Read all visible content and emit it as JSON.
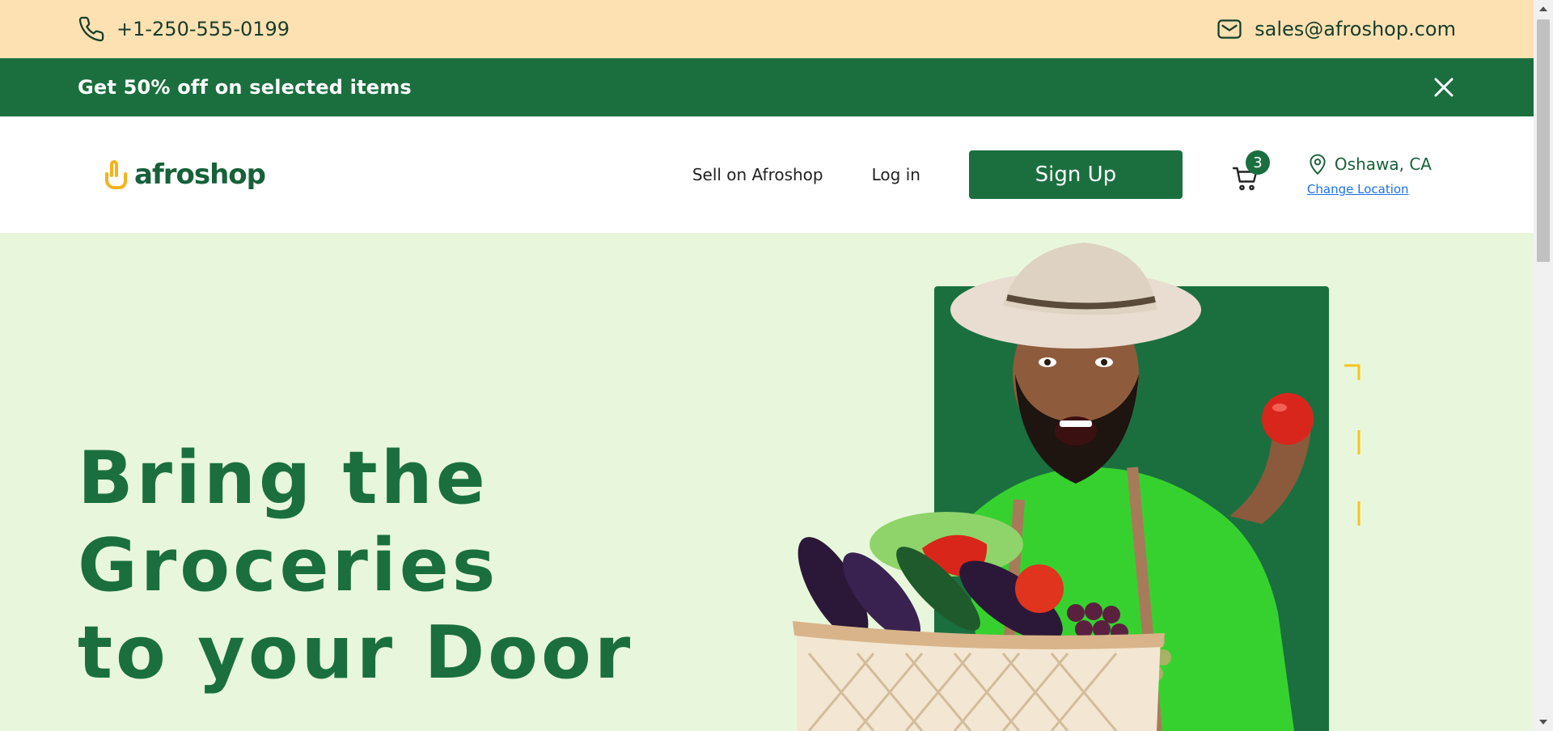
{
  "contact": {
    "phone": "+1-250-555-0199",
    "email": "sales@afroshop.com"
  },
  "promo": {
    "text": "Get 50% off on selected items"
  },
  "header": {
    "logo_text": "afroshop",
    "nav": {
      "sell": "Sell on Afroshop",
      "login": "Log in",
      "signup": "Sign Up"
    },
    "cart_count": "3",
    "location": {
      "city": "Oshawa, CA",
      "change_label": "Change Location"
    }
  },
  "hero": {
    "title_lines": [
      "Bring the",
      "Groceries",
      "to your Door"
    ]
  },
  "colors": {
    "brand_green": "#1b6f3f",
    "contact_bg": "#fde1b2",
    "hero_bg": "#e8f7dc",
    "accent_yellow": "#f5c518"
  },
  "icons": [
    "phone-icon",
    "mail-icon",
    "close-icon",
    "cart-icon",
    "location-pin-icon",
    "logo-hand-icon"
  ]
}
